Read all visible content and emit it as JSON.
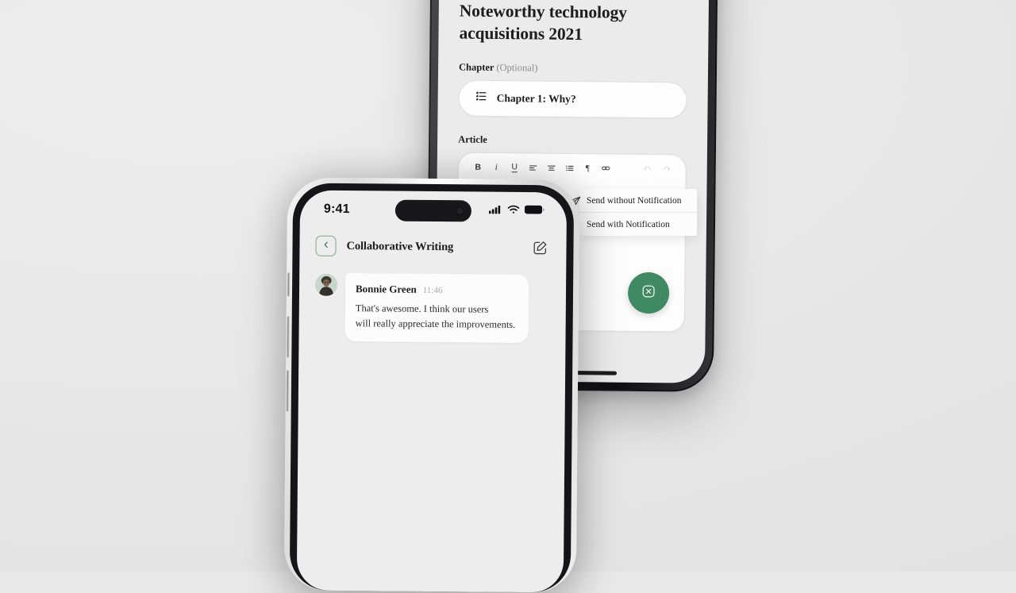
{
  "background_color": "#e9e9e9",
  "accent_color": "#3f8a63",
  "rear_phone": {
    "name": "article-editor-phone",
    "frame_color": "#1d1d1f",
    "article": {
      "title": "Noteworthy technology acquisitions 2021",
      "chapter_label": "Chapter",
      "chapter_optional": "(Optional)",
      "chapter_value": "Chapter 1: Why?",
      "chapter_icon": "list-outline-icon",
      "article_label": "Article"
    },
    "toolbar": {
      "items": [
        {
          "icon": "bold-icon",
          "label": "B"
        },
        {
          "icon": "italic-icon",
          "label": "i"
        },
        {
          "icon": "underline-icon",
          "label": "U"
        },
        {
          "icon": "align-left-icon",
          "label": ""
        },
        {
          "icon": "align-center-icon",
          "label": ""
        },
        {
          "icon": "ordered-list-icon",
          "label": ""
        },
        {
          "icon": "paragraph-icon",
          "label": "¶"
        },
        {
          "icon": "link-icon",
          "label": ""
        }
      ],
      "undo_icon": "undo-icon",
      "redo_icon": "redo-icon"
    },
    "fab": {
      "icon": "close-square-icon",
      "color": "#3f8a63"
    }
  },
  "send_menu": {
    "icon": "paper-plane-icon",
    "items": [
      {
        "label": "Send without Notification"
      },
      {
        "label": "Send with Notification"
      }
    ]
  },
  "front_phone": {
    "name": "chat-phone",
    "frame_color": "#ededed",
    "status_bar": {
      "time": "9:41",
      "icons": [
        "cellular-signal-icon",
        "wifi-icon",
        "battery-icon"
      ]
    },
    "chat": {
      "back_icon": "chevron-left-icon",
      "title": "Collaborative Writing",
      "compose_icon": "edit-square-icon",
      "messages": [
        {
          "avatar": "avatar",
          "sender": "Bonnie Green",
          "time": "11:46",
          "text": "That's awesome. I think our users\nwill really appreciate the improvements."
        }
      ]
    }
  }
}
